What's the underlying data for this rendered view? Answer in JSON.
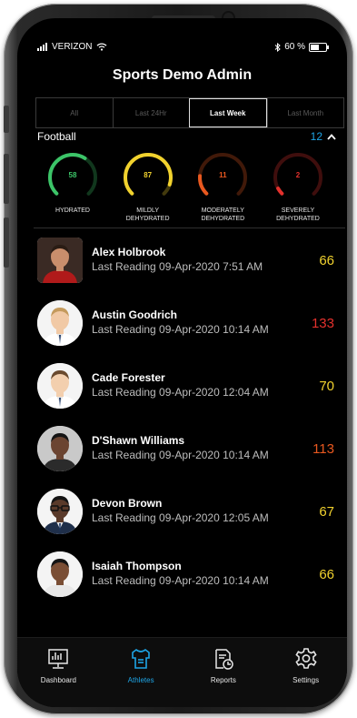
{
  "status_bar": {
    "carrier": "VERIZON",
    "battery": "60 %"
  },
  "app": {
    "title": "Sports Demo Admin"
  },
  "tabs": [
    {
      "label": "All",
      "active": false
    },
    {
      "label": "Last 24Hr",
      "active": false
    },
    {
      "label": "Last Week",
      "active": true
    },
    {
      "label": "Last Month",
      "active": false
    }
  ],
  "section": {
    "name": "Football",
    "count": "12",
    "toggle_icon": "chevron-up-icon"
  },
  "gauges": [
    {
      "value": "58",
      "label_line1": "HYDRATED",
      "label_line2": "",
      "color": "#3cc468",
      "fill": 0.62
    },
    {
      "value": "87",
      "label_line1": "MILDLY",
      "label_line2": "DEHYDRATED",
      "color": "#f1d22e",
      "fill": 0.9
    },
    {
      "value": "11",
      "label_line1": "MODERATELY",
      "label_line2": "DEHYDRATED",
      "color": "#e8581f",
      "fill": 0.18
    },
    {
      "value": "2",
      "label_line1": "SEVERELY",
      "label_line2": "DEHYDRATED",
      "color": "#e4312d",
      "fill": 0.06
    }
  ],
  "athletes": [
    {
      "name": "Alex Holbrook",
      "reading": "Last Reading 09-Apr-2020 7:51 AM",
      "value": "66",
      "color": "#f1d22e"
    },
    {
      "name": "Austin Goodrich",
      "reading": "Last Reading 09-Apr-2020 10:14 AM",
      "value": "133",
      "color": "#e4312d"
    },
    {
      "name": "Cade Forester",
      "reading": "Last Reading 09-Apr-2020 12:04 AM",
      "value": "70",
      "color": "#f1d22e"
    },
    {
      "name": "D'Shawn Williams",
      "reading": "Last Reading 09-Apr-2020 10:14 AM",
      "value": "113",
      "color": "#e8581f"
    },
    {
      "name": "Devon Brown",
      "reading": "Last Reading 09-Apr-2020 12:05 AM",
      "value": "67",
      "color": "#f1d22e"
    },
    {
      "name": "Isaiah Thompson",
      "reading": "Last Reading 09-Apr-2020 10:14 AM",
      "value": "66",
      "color": "#f1d22e"
    }
  ],
  "nav": [
    {
      "label": "Dashboard",
      "icon": "dashboard-icon",
      "active": false
    },
    {
      "label": "Athletes",
      "icon": "jersey-icon",
      "active": true
    },
    {
      "label": "Reports",
      "icon": "reports-icon",
      "active": false
    },
    {
      "label": "Settings",
      "icon": "gear-icon",
      "active": false
    }
  ],
  "colors": {
    "accent": "#1ea5e6",
    "background": "#000000"
  }
}
